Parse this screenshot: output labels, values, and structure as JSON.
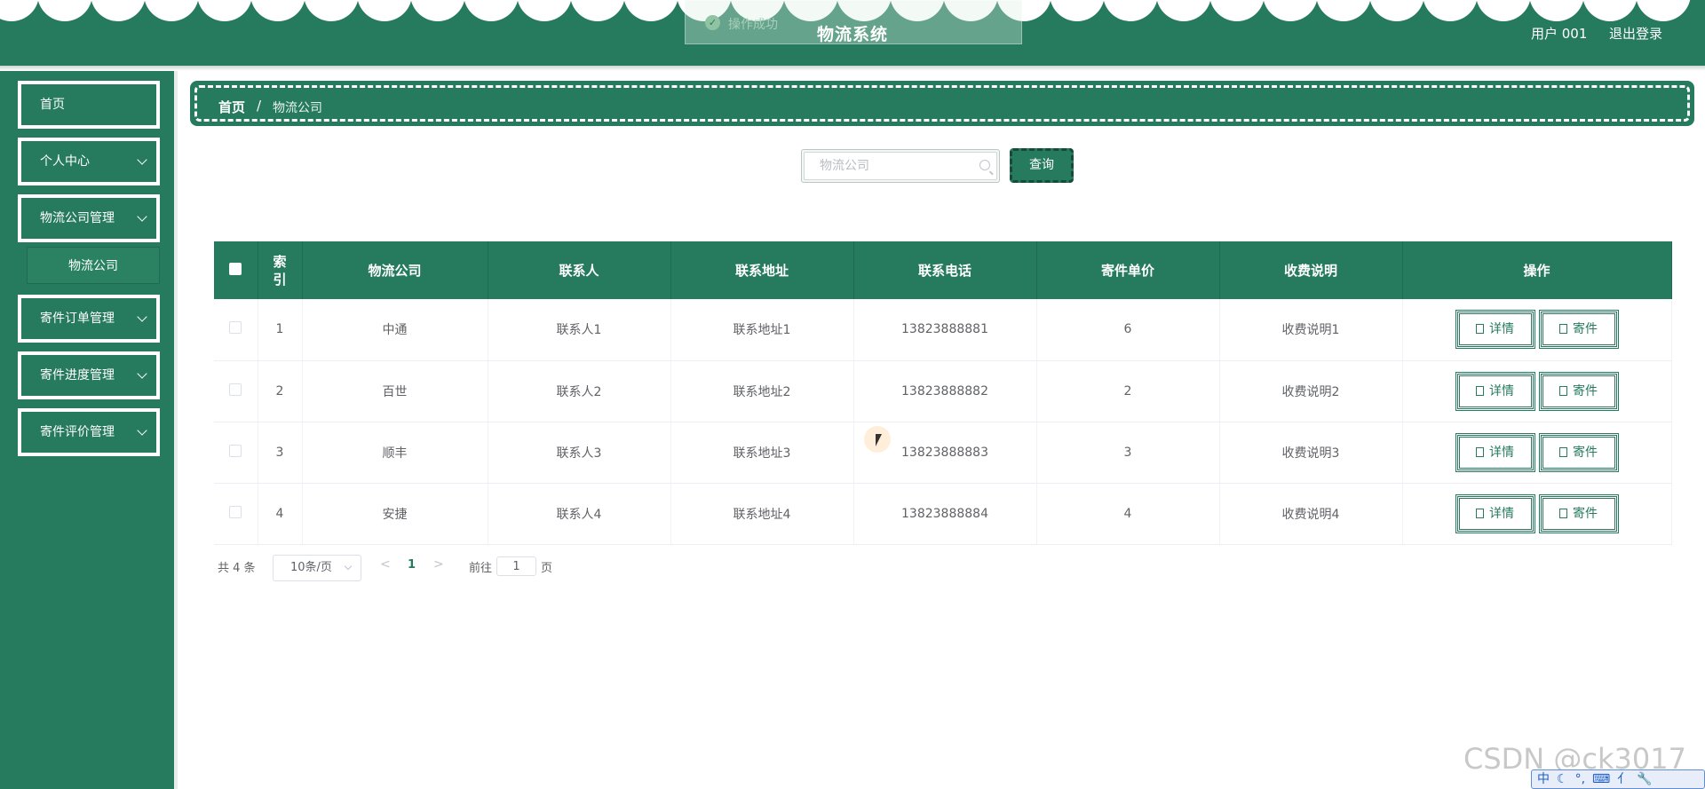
{
  "header": {
    "title": "物流系统",
    "toast": "操作成功",
    "user": "用户 001",
    "logout": "退出登录"
  },
  "sidebar": {
    "items": [
      {
        "label": "首页"
      },
      {
        "label": "个人中心"
      },
      {
        "label": "物流公司管理"
      },
      {
        "label": "寄件订单管理"
      },
      {
        "label": "寄件进度管理"
      },
      {
        "label": "寄件评价管理"
      }
    ],
    "submenu": "物流公司"
  },
  "breadcrumb": {
    "home": "首页",
    "separator": "/",
    "current": "物流公司"
  },
  "search": {
    "placeholder": "物流公司",
    "button": "查询"
  },
  "table": {
    "columns": [
      "索引",
      "物流公司",
      "联系人",
      "联系地址",
      "联系电话",
      "寄件单价",
      "收费说明",
      "操作"
    ],
    "rows": [
      {
        "index": "1",
        "company": "中通",
        "contact": "联系人1",
        "address": "联系地址1",
        "phone": "13823888881",
        "price": "6",
        "note": "收费说明1"
      },
      {
        "index": "2",
        "company": "百世",
        "contact": "联系人2",
        "address": "联系地址2",
        "phone": "13823888882",
        "price": "2",
        "note": "收费说明2"
      },
      {
        "index": "3",
        "company": "顺丰",
        "contact": "联系人3",
        "address": "联系地址3",
        "phone": "13823888883",
        "price": "3",
        "note": "收费说明3"
      },
      {
        "index": "4",
        "company": "安捷",
        "contact": "联系人4",
        "address": "联系地址4",
        "phone": "13823888884",
        "price": "4",
        "note": "收费说明4"
      }
    ],
    "actions": {
      "detail": "详情",
      "send": "寄件"
    }
  },
  "pagination": {
    "total": "共 4 条",
    "page_size": "10条/页",
    "current_page": "1",
    "goto_prefix": "前往",
    "goto_value": "1",
    "goto_suffix": "页"
  },
  "watermark": "CSDN @ck3017",
  "ime": [
    "中",
    "☾",
    "°,",
    "⌨",
    "⺅",
    "🔧"
  ],
  "colors": {
    "primary": "#267a5e",
    "background": "#ffffff"
  }
}
